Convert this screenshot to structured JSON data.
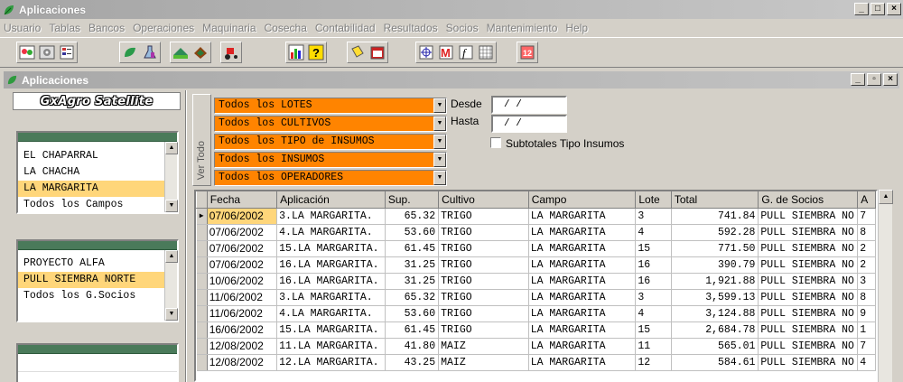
{
  "window": {
    "title": "Aplicaciones"
  },
  "menu": [
    "Usuario",
    "Tablas",
    "Bancos",
    "Operaciones",
    "Maquinaria",
    "Cosecha",
    "Contabilidad",
    "Resultados",
    "Socios",
    "Mantenimiento",
    "Help"
  ],
  "child_window": {
    "title": "Aplicaciones"
  },
  "logo": "GxAgro Satellite",
  "campos": {
    "items": [
      "EL CHAPARRAL",
      "LA CHACHA",
      "LA MARGARITA",
      "Todos los Campos"
    ],
    "selected": 2
  },
  "socios": {
    "items": [
      "PROYECTO ALFA",
      "PULL SIEMBRA NORTE",
      "Todos los G.Socios"
    ],
    "selected": 1
  },
  "filters": {
    "ver_todo": "Ver Todo",
    "combos": [
      "Todos los LOTES",
      "Todos los CULTIVOS",
      "Todos los TIPO de INSUMOS",
      "Todos los INSUMOS",
      "Todos los OPERADORES"
    ],
    "desde_label": "Desde",
    "hasta_label": "Hasta",
    "desde_value": "/  /",
    "hasta_value": "/  /",
    "subtotales_label": "Subtotales Tipo Insumos"
  },
  "grid": {
    "columns": [
      "Fecha",
      "Aplicación",
      "Sup.",
      "Cultivo",
      "Campo",
      "Lote",
      "Total",
      "G. de Socios",
      "A"
    ],
    "rows": [
      [
        "07/06/2002",
        "3.LA MARGARITA.",
        "65.32",
        "TRIGO",
        "LA MARGARITA",
        "3",
        "741.84",
        "PULL SIEMBRA NO",
        "7"
      ],
      [
        "07/06/2002",
        "4.LA MARGARITA.",
        "53.60",
        "TRIGO",
        "LA MARGARITA",
        "4",
        "592.28",
        "PULL SIEMBRA NO",
        "8"
      ],
      [
        "07/06/2002",
        "15.LA MARGARITA.",
        "61.45",
        "TRIGO",
        "LA MARGARITA",
        "15",
        "771.50",
        "PULL SIEMBRA NO",
        "2"
      ],
      [
        "07/06/2002",
        "16.LA MARGARITA.",
        "31.25",
        "TRIGO",
        "LA MARGARITA",
        "16",
        "390.79",
        "PULL SIEMBRA NO",
        "2"
      ],
      [
        "10/06/2002",
        "16.LA MARGARITA.",
        "31.25",
        "TRIGO",
        "LA MARGARITA",
        "16",
        "1,921.88",
        "PULL SIEMBRA NO",
        "3"
      ],
      [
        "11/06/2002",
        "3.LA MARGARITA.",
        "65.32",
        "TRIGO",
        "LA MARGARITA",
        "3",
        "3,599.13",
        "PULL SIEMBRA NO",
        "8"
      ],
      [
        "11/06/2002",
        "4.LA MARGARITA.",
        "53.60",
        "TRIGO",
        "LA MARGARITA",
        "4",
        "3,124.88",
        "PULL SIEMBRA NO",
        "9"
      ],
      [
        "16/06/2002",
        "15.LA MARGARITA.",
        "61.45",
        "TRIGO",
        "LA MARGARITA",
        "15",
        "2,684.78",
        "PULL SIEMBRA NO",
        "1"
      ],
      [
        "12/08/2002",
        "11.LA MARGARITA.",
        "41.80",
        "MAIZ",
        "LA MARGARITA",
        "11",
        "565.01",
        "PULL SIEMBRA NO",
        "7"
      ],
      [
        "12/08/2002",
        "12.LA MARGARITA.",
        "43.25",
        "MAIZ",
        "LA MARGARITA",
        "12",
        "584.61",
        "PULL SIEMBRA NO",
        "4"
      ]
    ],
    "current_row": 0
  }
}
